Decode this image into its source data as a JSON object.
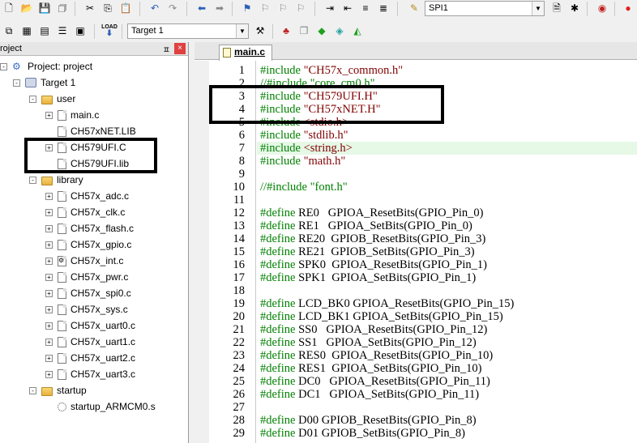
{
  "toolbar1": {
    "target_combo": "SPI1"
  },
  "toolbar2": {
    "target_select": "Target 1",
    "load_label": "LOAD"
  },
  "project_panel": {
    "title": "roject",
    "pin": "ㅍ",
    "close": "×",
    "tree": [
      {
        "label": "Project: project",
        "indent": 0,
        "icon": "project-icon",
        "expander": "-",
        "name": "tree-project"
      },
      {
        "label": "Target 1",
        "indent": 1,
        "icon": "target-icon",
        "expander": "-",
        "name": "tree-target"
      },
      {
        "label": "user",
        "indent": 2,
        "icon": "folder-icon",
        "expander": "-",
        "name": "tree-folder-user"
      },
      {
        "label": "main.c",
        "indent": 3,
        "icon": "file-icon",
        "expander": "+",
        "name": "tree-file-main-c"
      },
      {
        "label": "CH57xNET.LIB",
        "indent": 3,
        "icon": "file-icon",
        "expander": "",
        "name": "tree-file-ch57xnet-lib"
      },
      {
        "label": "CH579UFI.C",
        "indent": 3,
        "icon": "file-icon",
        "expander": "+",
        "name": "tree-file-ch579ufi-c"
      },
      {
        "label": "CH579UFI.lib",
        "indent": 3,
        "icon": "file-icon",
        "expander": "",
        "name": "tree-file-ch579ufi-lib"
      },
      {
        "label": "library",
        "indent": 2,
        "icon": "folder-icon",
        "expander": "-",
        "name": "tree-folder-library"
      },
      {
        "label": "CH57x_adc.c",
        "indent": 3,
        "icon": "file-icon",
        "expander": "+",
        "name": "tree-file-adc"
      },
      {
        "label": "CH57x_clk.c",
        "indent": 3,
        "icon": "file-icon",
        "expander": "+",
        "name": "tree-file-clk"
      },
      {
        "label": "CH57x_flash.c",
        "indent": 3,
        "icon": "file-icon",
        "expander": "+",
        "name": "tree-file-flash"
      },
      {
        "label": "CH57x_gpio.c",
        "indent": 3,
        "icon": "file-icon",
        "expander": "+",
        "name": "tree-file-gpio"
      },
      {
        "label": "CH57x_int.c",
        "indent": 3,
        "icon": "gear-file-icon",
        "expander": "+",
        "name": "tree-file-int"
      },
      {
        "label": "CH57x_pwr.c",
        "indent": 3,
        "icon": "file-icon",
        "expander": "+",
        "name": "tree-file-pwr"
      },
      {
        "label": "CH57x_spi0.c",
        "indent": 3,
        "icon": "file-icon",
        "expander": "+",
        "name": "tree-file-spi0"
      },
      {
        "label": "CH57x_sys.c",
        "indent": 3,
        "icon": "file-icon",
        "expander": "+",
        "name": "tree-file-sys"
      },
      {
        "label": "CH57x_uart0.c",
        "indent": 3,
        "icon": "file-icon",
        "expander": "+",
        "name": "tree-file-uart0"
      },
      {
        "label": "CH57x_uart1.c",
        "indent": 3,
        "icon": "file-icon",
        "expander": "+",
        "name": "tree-file-uart1"
      },
      {
        "label": "CH57x_uart2.c",
        "indent": 3,
        "icon": "file-icon",
        "expander": "+",
        "name": "tree-file-uart2"
      },
      {
        "label": "CH57x_uart3.c",
        "indent": 3,
        "icon": "file-icon",
        "expander": "+",
        "name": "tree-file-uart3"
      },
      {
        "label": "startup",
        "indent": 2,
        "icon": "folder-icon",
        "expander": "-",
        "name": "tree-folder-startup"
      },
      {
        "label": "startup_ARMCM0.s",
        "indent": 3,
        "icon": "asm-file-icon",
        "expander": "",
        "name": "tree-file-startup"
      }
    ]
  },
  "editor": {
    "tab_label": "main.c",
    "highlight_line": 7,
    "lines": [
      {
        "n": "1",
        "parts": [
          [
            "pp",
            "#include "
          ],
          [
            "str",
            "\"CH57x_common.h\""
          ]
        ]
      },
      {
        "n": "2",
        "parts": [
          [
            "cm",
            "//#include \"core_cm0.h\""
          ]
        ]
      },
      {
        "n": "3",
        "parts": [
          [
            "pp",
            "#include "
          ],
          [
            "str",
            "\"CH579UFI.H\""
          ]
        ]
      },
      {
        "n": "4",
        "parts": [
          [
            "pp",
            "#include "
          ],
          [
            "str",
            "\"CH57xNET.H\""
          ]
        ]
      },
      {
        "n": "5",
        "parts": [
          [
            "pp",
            "#include "
          ],
          [
            "str",
            "<stdio.h>"
          ]
        ]
      },
      {
        "n": "6",
        "parts": [
          [
            "pp",
            "#include "
          ],
          [
            "str",
            "\"stdlib.h\""
          ]
        ]
      },
      {
        "n": "7",
        "parts": [
          [
            "pp",
            "#include "
          ],
          [
            "str",
            "<string.h>"
          ]
        ]
      },
      {
        "n": "8",
        "parts": [
          [
            "pp",
            "#include "
          ],
          [
            "str",
            "\"math.h\""
          ]
        ]
      },
      {
        "n": "9",
        "parts": []
      },
      {
        "n": "10",
        "parts": [
          [
            "cm",
            "//#include \"font.h\""
          ]
        ]
      },
      {
        "n": "11",
        "parts": []
      },
      {
        "n": "12",
        "parts": [
          [
            "pp",
            "#define "
          ],
          [
            "fn",
            "RE0   GPIOA_ResetBits(GPIO_Pin_0)"
          ]
        ]
      },
      {
        "n": "13",
        "parts": [
          [
            "pp",
            "#define "
          ],
          [
            "fn",
            "RE1   GPIOA_SetBits(GPIO_Pin_0)"
          ]
        ]
      },
      {
        "n": "14",
        "parts": [
          [
            "pp",
            "#define "
          ],
          [
            "fn",
            "RE20  GPIOB_ResetBits(GPIO_Pin_3)"
          ]
        ]
      },
      {
        "n": "15",
        "parts": [
          [
            "pp",
            "#define "
          ],
          [
            "fn",
            "RE21  GPIOB_SetBits(GPIO_Pin_3)"
          ]
        ]
      },
      {
        "n": "16",
        "parts": [
          [
            "pp",
            "#define "
          ],
          [
            "fn",
            "SPK0  GPIOA_ResetBits(GPIO_Pin_1)"
          ]
        ]
      },
      {
        "n": "17",
        "parts": [
          [
            "pp",
            "#define "
          ],
          [
            "fn",
            "SPK1  GPIOA_SetBits(GPIO_Pin_1)"
          ]
        ]
      },
      {
        "n": "18",
        "parts": []
      },
      {
        "n": "19",
        "parts": [
          [
            "pp",
            "#define "
          ],
          [
            "fn",
            "LCD_BK0 GPIOA_ResetBits(GPIO_Pin_15)"
          ]
        ]
      },
      {
        "n": "20",
        "parts": [
          [
            "pp",
            "#define "
          ],
          [
            "fn",
            "LCD_BK1 GPIOA_SetBits(GPIO_Pin_15)"
          ]
        ]
      },
      {
        "n": "21",
        "parts": [
          [
            "pp",
            "#define "
          ],
          [
            "fn",
            "SS0   GPIOA_ResetBits(GPIO_Pin_12)"
          ]
        ]
      },
      {
        "n": "22",
        "parts": [
          [
            "pp",
            "#define "
          ],
          [
            "fn",
            "SS1   GPIOA_SetBits(GPIO_Pin_12)"
          ]
        ]
      },
      {
        "n": "23",
        "parts": [
          [
            "pp",
            "#define "
          ],
          [
            "fn",
            "RES0  GPIOA_ResetBits(GPIO_Pin_10)"
          ]
        ]
      },
      {
        "n": "24",
        "parts": [
          [
            "pp",
            "#define "
          ],
          [
            "fn",
            "RES1  GPIOA_SetBits(GPIO_Pin_10)"
          ]
        ]
      },
      {
        "n": "25",
        "parts": [
          [
            "pp",
            "#define "
          ],
          [
            "fn",
            "DC0   GPIOA_ResetBits(GPIO_Pin_11)"
          ]
        ]
      },
      {
        "n": "26",
        "parts": [
          [
            "pp",
            "#define "
          ],
          [
            "fn",
            "DC1   GPIOA_SetBits(GPIO_Pin_11)"
          ]
        ]
      },
      {
        "n": "27",
        "parts": []
      },
      {
        "n": "28",
        "parts": [
          [
            "pp",
            "#define "
          ],
          [
            "fn",
            "D00 GPIOB_ResetBits(GPIO_Pin_8)"
          ]
        ]
      },
      {
        "n": "29",
        "parts": [
          [
            "pp",
            "#define "
          ],
          [
            "fn",
            "D01 GPIOB_SetBits(GPIO_Pin_8)"
          ]
        ]
      }
    ]
  },
  "colors": {
    "preprocessor": "#008000",
    "string": "#800000",
    "highlight": "#e6f8e6"
  }
}
